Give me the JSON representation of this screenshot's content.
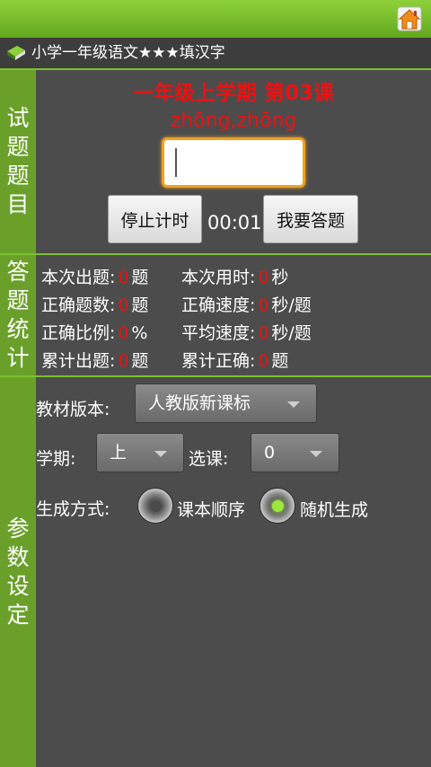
{
  "app": {
    "title": "小学一年级语文★★★填汉字"
  },
  "sections": {
    "question": "试题题目",
    "stats": "答题统计",
    "settings": "参数设定"
  },
  "question": {
    "lesson": "一年级上学期 第03课",
    "pinyin": "zhōng,zhōng",
    "answer_value": "",
    "stop_button": "停止计时",
    "timer": "00:01",
    "answer_button": "我要答题"
  },
  "stats": {
    "row1": {
      "l1": "本次出题:",
      "v1": "0",
      "u1": "题",
      "l2": "本次用时:",
      "v2": "0",
      "u2": "秒"
    },
    "row2": {
      "l1": "正确题数:",
      "v1": "0",
      "u1": "题",
      "l2": "正确速度:",
      "v2": "0",
      "u2": "秒/题"
    },
    "row3": {
      "l1": "正确比例:",
      "v1": "0",
      "u1": "%",
      "l2": "平均速度:",
      "v2": "0",
      "u2": "秒/题"
    },
    "row4": {
      "l1": "累计出题:",
      "v1": "0",
      "u1": "题",
      "l2": "累计正确:",
      "v2": "0",
      "u2": "题"
    }
  },
  "settings": {
    "textbook_label": "教材版本:",
    "textbook_value": "人教版新课标",
    "term_label": "学期:",
    "term_value": "上",
    "lesson_label": "选课:",
    "lesson_value": "0",
    "mode_label": "生成方式:",
    "mode_options": [
      {
        "label": "课本顺序",
        "selected": false
      },
      {
        "label": "随机生成",
        "selected": true
      }
    ]
  },
  "colors": {
    "accent_green": "#6aa02a",
    "highlight_red": "#ee1010",
    "radio_on": "#9be83a"
  },
  "icons": {
    "home": "home-icon",
    "book": "book-icon"
  }
}
